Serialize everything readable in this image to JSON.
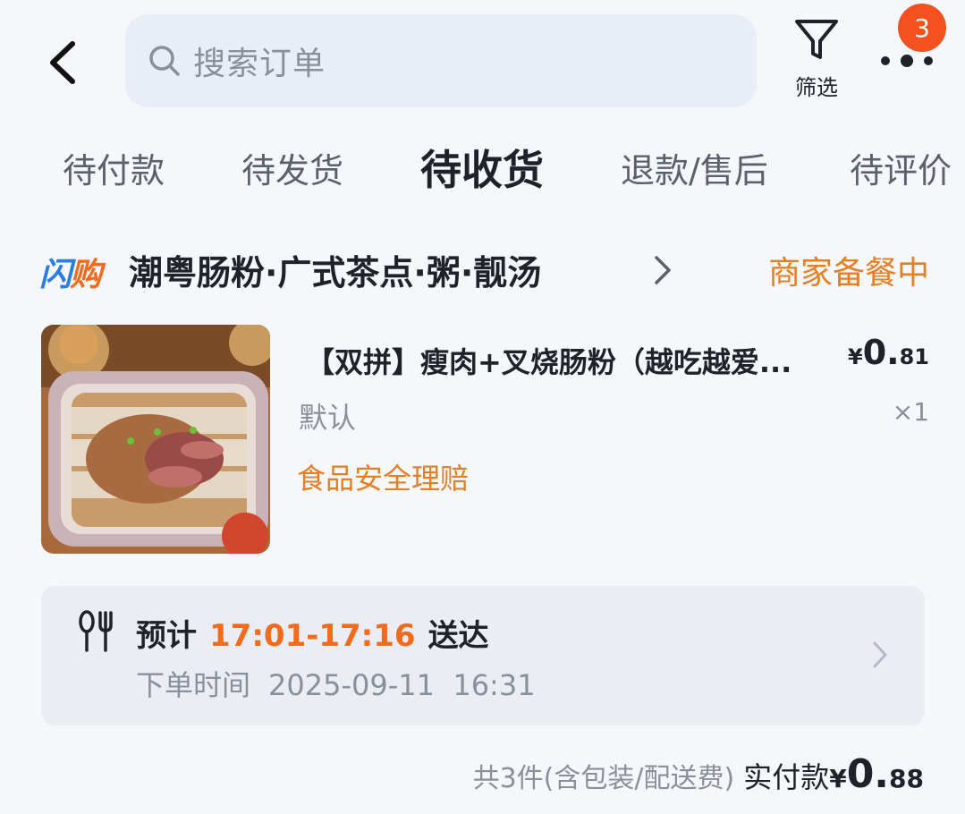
{
  "header": {
    "search_placeholder": "搜索订单",
    "filter_label": "筛选",
    "notification_count": "3"
  },
  "tabs": [
    {
      "label": "待付款"
    },
    {
      "label": "待发货"
    },
    {
      "label": "待收货",
      "active": true
    },
    {
      "label": "退款/售后"
    },
    {
      "label": "待评价"
    }
  ],
  "store": {
    "brand": "闪购",
    "name": "潮粤肠粉·广式茶点·粥·靓汤",
    "status": "商家备餐中"
  },
  "product": {
    "title": "【双拼】瘦肉+叉烧肠粉（越吃越爱...",
    "price_currency": "¥",
    "price_int": "0.",
    "price_dec": "81",
    "spec": "默认",
    "qty": "×1",
    "service_tag": "食品安全理赔"
  },
  "delivery": {
    "eta_prefix": "预计",
    "eta_time": "17:01-17:16",
    "eta_suffix": "送达",
    "order_time_label": "下单时间",
    "order_time_value": "2025-09-11  16:31"
  },
  "summary": {
    "note": "共3件(含包装/配送费)",
    "paid_label": "实付款",
    "currency": "¥",
    "amount_int": "0.",
    "amount_dec": "88"
  },
  "colors": {
    "accent_orange": "#f26b1d",
    "badge_red": "#f4511e",
    "brand_blue": "#2a7de1"
  }
}
